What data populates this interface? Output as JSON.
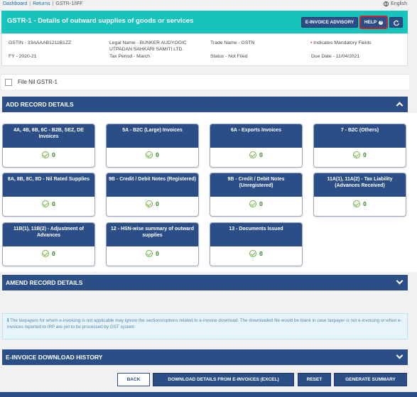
{
  "breadcrumb": {
    "items": [
      "Dashboard",
      "Returns",
      "GSTR-1/IFF"
    ]
  },
  "language": "English",
  "header": {
    "title": "GSTR-1 - Details of outward supplies of goods or services",
    "einvoice_advisory": "E-INVOICE ADVISORY",
    "help": "HELP",
    "refresh_icon": "refresh-icon"
  },
  "details": {
    "gstin": "GSTIN - 33AAAAB1211B1ZZ",
    "fy": "FY - 2020-21",
    "legal_name_1": "Legal Name - BUNKER AUDYOGIC",
    "legal_name_2": "UTPADAN SAHKARI SAMITI LTD.",
    "tax_period": "Tax Period - March",
    "trade_name": "Trade Name - GSTN",
    "status": "Status - Not Filed",
    "mandatory": "Indicates Mandatory Fields",
    "due_date": "Due Date - 11/04/2021"
  },
  "file_nil": "File Nil GSTR-1",
  "sections": {
    "add_record": "ADD RECORD DETAILS",
    "amend_record": "AMEND RECORD DETAILS",
    "einvoice_history": "E-INVOICE DOWNLOAD HISTORY"
  },
  "tiles": [
    {
      "label": "4A, 4B, 6B, 6C - B2B, SEZ, DE Invoices",
      "count": "0"
    },
    {
      "label": "5A - B2C (Large) Invoices",
      "count": "0"
    },
    {
      "label": "6A - Exports Invoices",
      "count": "0"
    },
    {
      "label": "7 - B2C (Others)",
      "count": "0"
    },
    {
      "label": "8A, 8B, 8C, 8D - Nil Rated Supplies",
      "count": "0"
    },
    {
      "label": "9B - Credit / Debit Notes (Registered)",
      "count": "0"
    },
    {
      "label": "9B - Credit / Debit Notes (Unregistered)",
      "count": "0"
    },
    {
      "label": "11A(1), 11A(2) - Tax Liability (Advances Received)",
      "count": "0"
    },
    {
      "label": "11B(1), 11B(2) - Adjustment of Advances",
      "count": "0"
    },
    {
      "label": "12 - HSN-wise summary of outward supplies",
      "count": "0"
    },
    {
      "label": "13 - Documents Issued",
      "count": "0"
    }
  ],
  "notice": "The taxpayers for whom e-invoicing is not applicable may ignore the sections/options related to e-invoice download. The downloaded file would be blank in case taxpayer is not e-invoicing or when e-invoices reported to IRP are yet to be processed by GST system",
  "buttons": {
    "back": "BACK",
    "download": "DOWNLOAD DETAILS FROM E-INVOICES (EXCEL)",
    "reset": "RESET",
    "generate": "GENERATE SUMMARY"
  },
  "colors": {
    "header": "#17c4bb",
    "primary": "#2c4e86",
    "highlight": "#d0202c",
    "success": "#6db33f"
  }
}
